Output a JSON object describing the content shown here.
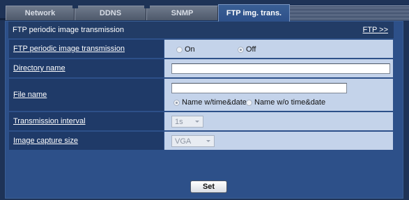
{
  "tabs": [
    {
      "label": "Network"
    },
    {
      "label": "DDNS"
    },
    {
      "label": "SNMP"
    },
    {
      "label": "FTP img. trans."
    }
  ],
  "section": {
    "title": "FTP periodic image transmission",
    "link": "FTP >>"
  },
  "fields": {
    "transmission": {
      "label": "FTP periodic image transmission",
      "on_label": "On",
      "off_label": "Off",
      "selected": "Off"
    },
    "directory": {
      "label": "Directory name",
      "value": ""
    },
    "filename": {
      "label": "File name",
      "value": "",
      "opt_with": "Name w/time&date",
      "opt_without": "Name w/o time&date",
      "selected": "Name w/time&date"
    },
    "interval": {
      "label": "Transmission interval",
      "value": "1s"
    },
    "capture_size": {
      "label": "Image capture size",
      "value": "VGA"
    }
  },
  "buttons": {
    "set": "Set"
  },
  "colors": {
    "background": "#1e3357",
    "panel": "#2d5089",
    "label_cell": "#1f3a68",
    "value_cell": "#c4d3ea",
    "active_tab": "#3a5f95"
  }
}
